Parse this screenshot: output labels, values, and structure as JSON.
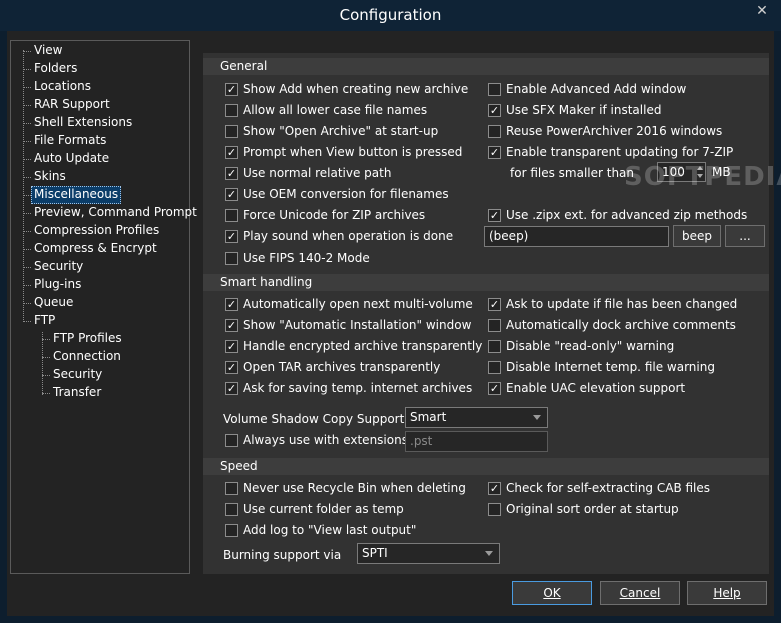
{
  "window": {
    "title": "Configuration",
    "close_glyph": "✕"
  },
  "tree": {
    "items": [
      "View",
      "Folders",
      "Locations",
      "RAR Support",
      "Shell Extensions",
      "File Formats",
      "Auto Update",
      "Skins",
      "Miscellaneous",
      "Preview, Command Prompt",
      "Compression Profiles",
      "Compress & Encrypt",
      "Security",
      "Plug-ins",
      "Queue",
      "FTP"
    ],
    "ftp_children": [
      "FTP Profiles",
      "Connection",
      "Security",
      "Transfer"
    ],
    "selected": "Miscellaneous"
  },
  "general": {
    "header": "General",
    "left": [
      {
        "label": "Show Add when creating new archive",
        "checked": true
      },
      {
        "label": "Allow all lower case file names",
        "checked": false
      },
      {
        "label": "Show \"Open Archive\" at start-up",
        "checked": false
      },
      {
        "label": "Prompt when View button is pressed",
        "checked": true
      },
      {
        "label": "Use normal relative path",
        "checked": true
      },
      {
        "label": "Use OEM conversion for filenames",
        "checked": true
      },
      {
        "label": "Force Unicode for ZIP archives",
        "checked": false
      },
      {
        "label": "Play sound when operation is done",
        "checked": true
      },
      {
        "label": "Use FIPS 140-2 Mode",
        "checked": false
      }
    ],
    "right": [
      {
        "label": "Enable Advanced Add window",
        "checked": false
      },
      {
        "label": "Use SFX Maker if installed",
        "checked": true
      },
      {
        "label": "Reuse PowerArchiver 2016 windows",
        "checked": false
      },
      {
        "label": "Enable transparent updating for 7-ZIP",
        "checked": true
      },
      {
        "label": "Use .zipx ext. for advanced zip methods",
        "checked": true
      }
    ],
    "files_smaller_label": "for files smaller than",
    "files_smaller_value": "100",
    "mb_label": "MB",
    "sound_value": "(beep)",
    "beep_button": "beep",
    "browse_button": "..."
  },
  "smart": {
    "header": "Smart handling",
    "left": [
      {
        "label": "Automatically open next multi-volume",
        "checked": true
      },
      {
        "label": "Show \"Automatic Installation\" window",
        "checked": true
      },
      {
        "label": "Handle encrypted archive transparently",
        "checked": true
      },
      {
        "label": "Open TAR archives transparently",
        "checked": true
      },
      {
        "label": "Ask for saving temp. internet archives",
        "checked": true
      }
    ],
    "right": [
      {
        "label": "Ask to update if file has been changed",
        "checked": true
      },
      {
        "label": "Automatically dock archive comments",
        "checked": false
      },
      {
        "label": "Disable \"read-only\" warning",
        "checked": false
      },
      {
        "label": "Disable Internet temp. file warning",
        "checked": false
      },
      {
        "label": "Enable UAC elevation support",
        "checked": true
      }
    ],
    "vsc_label": "Volume Shadow Copy Support:",
    "vsc_value": "Smart",
    "always_ext": {
      "label": "Always use with extensions:",
      "checked": false
    },
    "ext_value": ".pst"
  },
  "speed": {
    "header": "Speed",
    "left": [
      {
        "label": "Never use Recycle Bin when deleting",
        "checked": false
      },
      {
        "label": "Use current folder as temp",
        "checked": false
      },
      {
        "label": "Add log to \"View last output\"",
        "checked": false
      }
    ],
    "right": [
      {
        "label": "Check for self-extracting CAB files",
        "checked": true
      },
      {
        "label": "Original sort order at startup",
        "checked": false
      }
    ],
    "burn_label": "Burning support via",
    "burn_value": "SPTI"
  },
  "footer": {
    "ok": "OK",
    "cancel": "Cancel",
    "help": "Help"
  },
  "watermark": "SOFTPEDIA",
  "colors": {
    "title_bg": "#0f2336",
    "panel_bg": "#323232",
    "selected_bg": "#0b3d69",
    "accent_border": "#4a9be0"
  }
}
